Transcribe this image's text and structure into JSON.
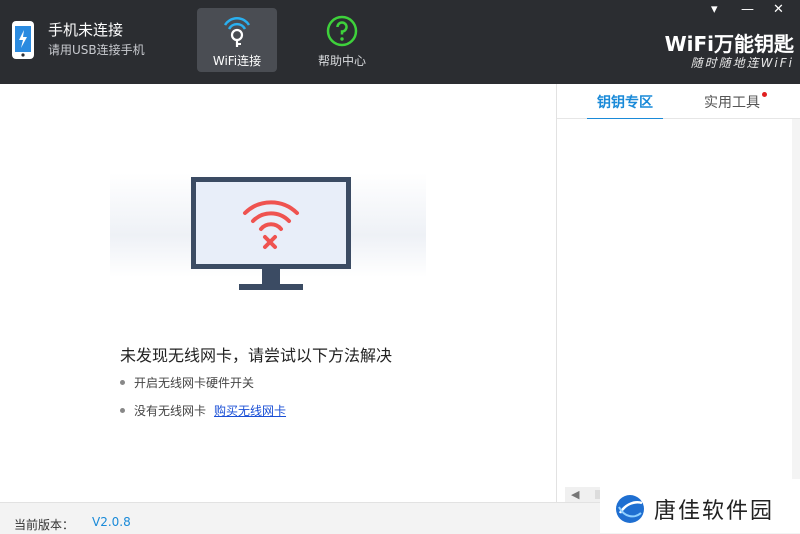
{
  "header": {
    "phone_title": "手机未连接",
    "phone_subtitle": "请用USB连接手机",
    "nav": [
      {
        "label": "WiFi连接",
        "icon": "wifi-key-icon",
        "active": true
      },
      {
        "label": "帮助中心",
        "icon": "help-icon",
        "active": false
      }
    ],
    "window_controls": {
      "menu": "▾",
      "minimize": "—",
      "close": "✕"
    },
    "brand_title": "WiFi万能钥匙",
    "brand_slogan": "随时随地连WiFi"
  },
  "main": {
    "headline": "未发现无线网卡，请尝试以下方法解决",
    "tips": [
      {
        "text": "开启无线网卡硬件开关"
      },
      {
        "text": "没有无线网卡",
        "link": "购买无线网卡"
      }
    ]
  },
  "side": {
    "tabs": [
      {
        "label": "钥钥专区",
        "active": true
      },
      {
        "label": "实用工具",
        "badge": true
      }
    ]
  },
  "footer": {
    "version_label": "当前版本：",
    "version_value": "V2.0.8"
  },
  "watermark": {
    "text": "唐佳软件园"
  },
  "colors": {
    "header_bg": "#2b2d31",
    "accent": "#1a8ad8",
    "wifi_red": "#ef5350",
    "monitor_frame": "#3b4b63",
    "help_green": "#3ed13b"
  }
}
